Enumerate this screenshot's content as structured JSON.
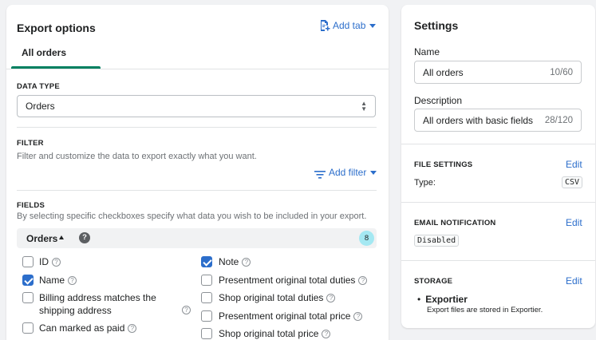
{
  "export_options": {
    "title": "Export options",
    "add_tab_label": "Add tab",
    "tab_label": "All orders",
    "data_type": {
      "heading": "DATA TYPE",
      "selected": "Orders"
    },
    "filter": {
      "heading": "FILTER",
      "description": "Filter and customize the data to export exactly what you want.",
      "add_filter_label": "Add filter"
    },
    "fields": {
      "heading": "FIELDS",
      "description": "By selecting specific checkboxes specify what data you wish to be included in your export.",
      "group_label": "Orders",
      "group_count": "8",
      "items_left": [
        {
          "label": "ID",
          "checked": false
        },
        {
          "label": "Name",
          "checked": true
        },
        {
          "label": "Billing address matches the",
          "label2": "shipping address",
          "checked": false
        },
        {
          "label": "Can marked as paid",
          "checked": false
        }
      ],
      "items_right": [
        {
          "label": "Note",
          "checked": true
        },
        {
          "label": "Presentment original total duties",
          "checked": false
        },
        {
          "label": "Shop original total duties",
          "checked": false
        },
        {
          "label": "Presentment original total price",
          "checked": false
        },
        {
          "label": "Shop original total price",
          "checked": false
        }
      ]
    }
  },
  "settings": {
    "title": "Settings",
    "name_label": "Name",
    "name_value": "All orders",
    "name_count": "10/60",
    "description_label": "Description",
    "description_value": "All orders with basic fields",
    "description_count": "28/120",
    "file_settings": {
      "heading": "FILE SETTINGS",
      "edit_label": "Edit",
      "type_label": "Type:",
      "type_value": "CSV"
    },
    "email_notification": {
      "heading": "EMAIL NOTIFICATION",
      "edit_label": "Edit",
      "value": "Disabled"
    },
    "storage": {
      "heading": "STORAGE",
      "edit_label": "Edit",
      "item_name": "Exportier",
      "item_description": "Export files are stored in Exportier."
    }
  },
  "colors": {
    "accent": "#2c6ecb",
    "tab_underline": "#008060",
    "badge_bg": "#a4e8f2"
  },
  "icons": {
    "add_tab": "document-plus-icon",
    "add_tab_chevron": "chevron-down-icon",
    "filter": "filter-lines-icon",
    "help": "question-circle-icon",
    "group_toggle": "caret-up-icon",
    "group_help": "question-filled-icon",
    "select_arrows": "select-arrows-icon"
  }
}
